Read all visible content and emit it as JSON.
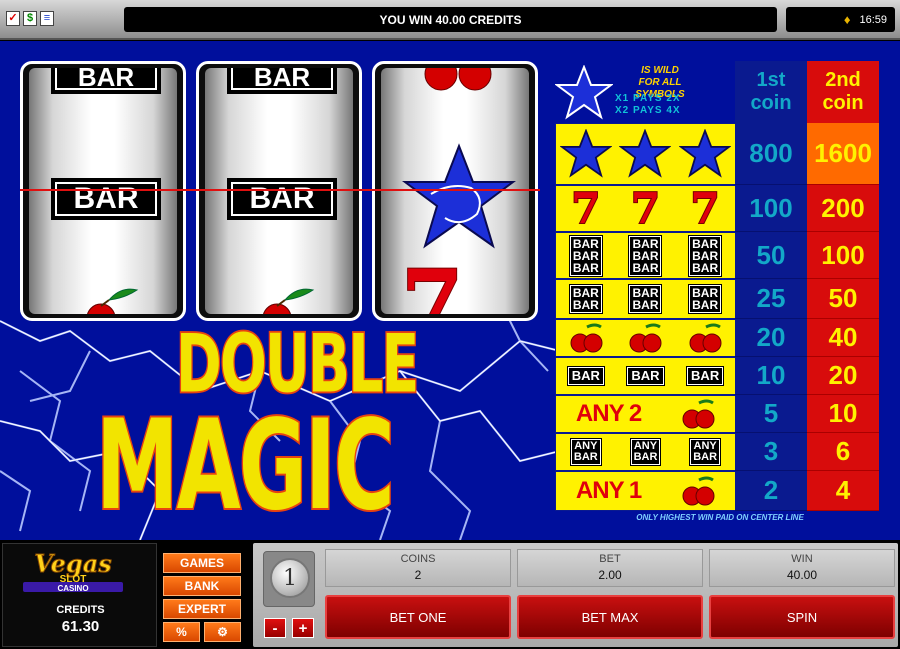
{
  "topbar": {
    "message": "YOU WIN 40.00 CREDITS",
    "time": "16:59",
    "icons": [
      "checklist-icon",
      "dollar-icon",
      "list-icon",
      "money-bag-icon"
    ]
  },
  "reels": {
    "reel1": {
      "top_symbol": "BAR",
      "center_symbol": "BAR",
      "bottom_symbol": "cherry"
    },
    "reel2": {
      "top_symbol": "BAR",
      "center_symbol": "BAR",
      "bottom_symbol": "cherry"
    },
    "reel3": {
      "top_symbol": "cherry",
      "center_symbol": "star",
      "bottom_symbol": "seven"
    }
  },
  "logo": {
    "line1": "DOUBLE",
    "line2": "MAGIC"
  },
  "paytable": {
    "wild_text_1": "IS WILD",
    "wild_text_2": "FOR ALL SYMBOLS",
    "wild_pays_1": "X1 PAYS 2X",
    "wild_pays_2": "X2 PAYS 4X",
    "header_1st_a": "1st",
    "header_1st_b": "coin",
    "header_2nd_a": "2nd",
    "header_2nd_b": "coin",
    "bar_label": "BAR",
    "any_label": "ANY",
    "rows": [
      {
        "combo": "star star star",
        "coin1": "800",
        "coin2": "1600"
      },
      {
        "combo": "7 7 7",
        "coin1": "100",
        "coin2": "200"
      },
      {
        "combo": "triple bar x3",
        "coin1": "50",
        "coin2": "100"
      },
      {
        "combo": "double bar x3",
        "coin1": "25",
        "coin2": "50"
      },
      {
        "combo": "cherry x3",
        "coin1": "20",
        "coin2": "40"
      },
      {
        "combo": "bar x3",
        "coin1": "10",
        "coin2": "20"
      },
      {
        "combo": "ANY 2",
        "coin1": "5",
        "coin2": "10"
      },
      {
        "combo": "any bar x3",
        "coin1": "3",
        "coin2": "6"
      },
      {
        "combo": "ANY 1",
        "coin1": "2",
        "coin2": "4"
      }
    ],
    "any2": "ANY 2",
    "any1": "ANY 1",
    "footnote": "ONLY HIGHEST WIN PAID ON CENTER LINE"
  },
  "brand": {
    "vegas": "Vegas",
    "slot": "SLOT",
    "casino": "CASINO",
    "credits_label": "CREDITS",
    "credits_value": "61.30"
  },
  "menu": {
    "games": "GAMES",
    "bank": "BANK",
    "expert": "EXPERT",
    "percent": "%",
    "gear": "⚙"
  },
  "controls": {
    "coin_value": "1",
    "minus": "-",
    "plus": "+",
    "coins_label": "COINS",
    "coins_value": "2",
    "bet_label": "BET",
    "bet_value": "2.00",
    "win_label": "WIN",
    "win_value": "40.00",
    "bet_one": "BET ONE",
    "bet_max": "BET MAX",
    "spin": "SPIN"
  },
  "colors": {
    "game_bg": "#000f9c",
    "pay_yellow": "#fff200",
    "pay_red": "#d80c0c",
    "pay_blue": "#0a1a8f",
    "hot_cell": "#ff6a00"
  }
}
